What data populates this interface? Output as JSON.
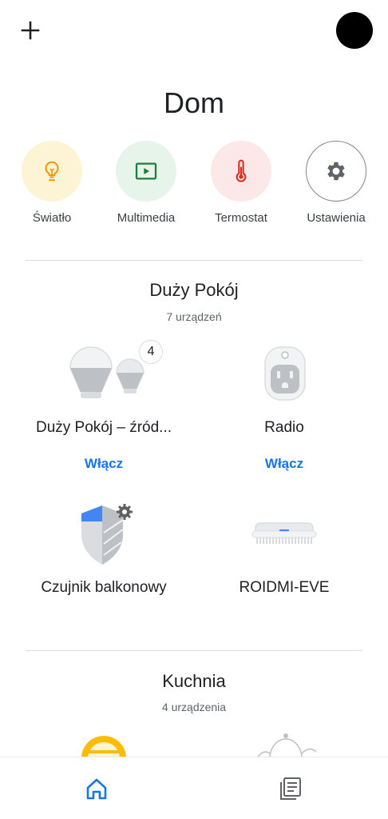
{
  "header": {
    "title": "Dom"
  },
  "shortcuts": [
    {
      "label": "Światło",
      "icon": "lightbulb-icon",
      "bg": "#fdf3d5",
      "color": "#f29900"
    },
    {
      "label": "Multimedia",
      "icon": "play-icon",
      "bg": "#e6f4ea",
      "color": "#188038"
    },
    {
      "label": "Termostat",
      "icon": "thermometer-icon",
      "bg": "#fce8e6",
      "color": "#d93025"
    },
    {
      "label": "Ustawienia",
      "icon": "gear-icon",
      "bg": "#ffffff",
      "color": "#5f6368"
    }
  ],
  "rooms": [
    {
      "name": "Duży Pokój",
      "count": "7 urządzeń",
      "devices": [
        {
          "name": "Duży Pokój – źród...",
          "action": "Włącz",
          "badge": "4",
          "icon": "light-bulbs-icon"
        },
        {
          "name": "Radio",
          "action": "Włącz",
          "icon": "smart-plug-icon"
        },
        {
          "name": "Czujnik balkonowy",
          "icon": "sensor-shield-icon"
        },
        {
          "name": "ROIDMI-EVE",
          "icon": "vacuum-icon"
        }
      ]
    },
    {
      "name": "Kuchnia",
      "count": "4 urządzenia",
      "devices": [
        {
          "icon": "lamp-icon"
        },
        {
          "icon": "kettle-icon"
        }
      ]
    }
  ],
  "nav": [
    {
      "icon": "home-icon",
      "active": true
    },
    {
      "icon": "feed-icon",
      "active": false
    }
  ],
  "colors": {
    "accent": "#1a73e8",
    "text": "#202124",
    "divider": "#dadce0"
  }
}
